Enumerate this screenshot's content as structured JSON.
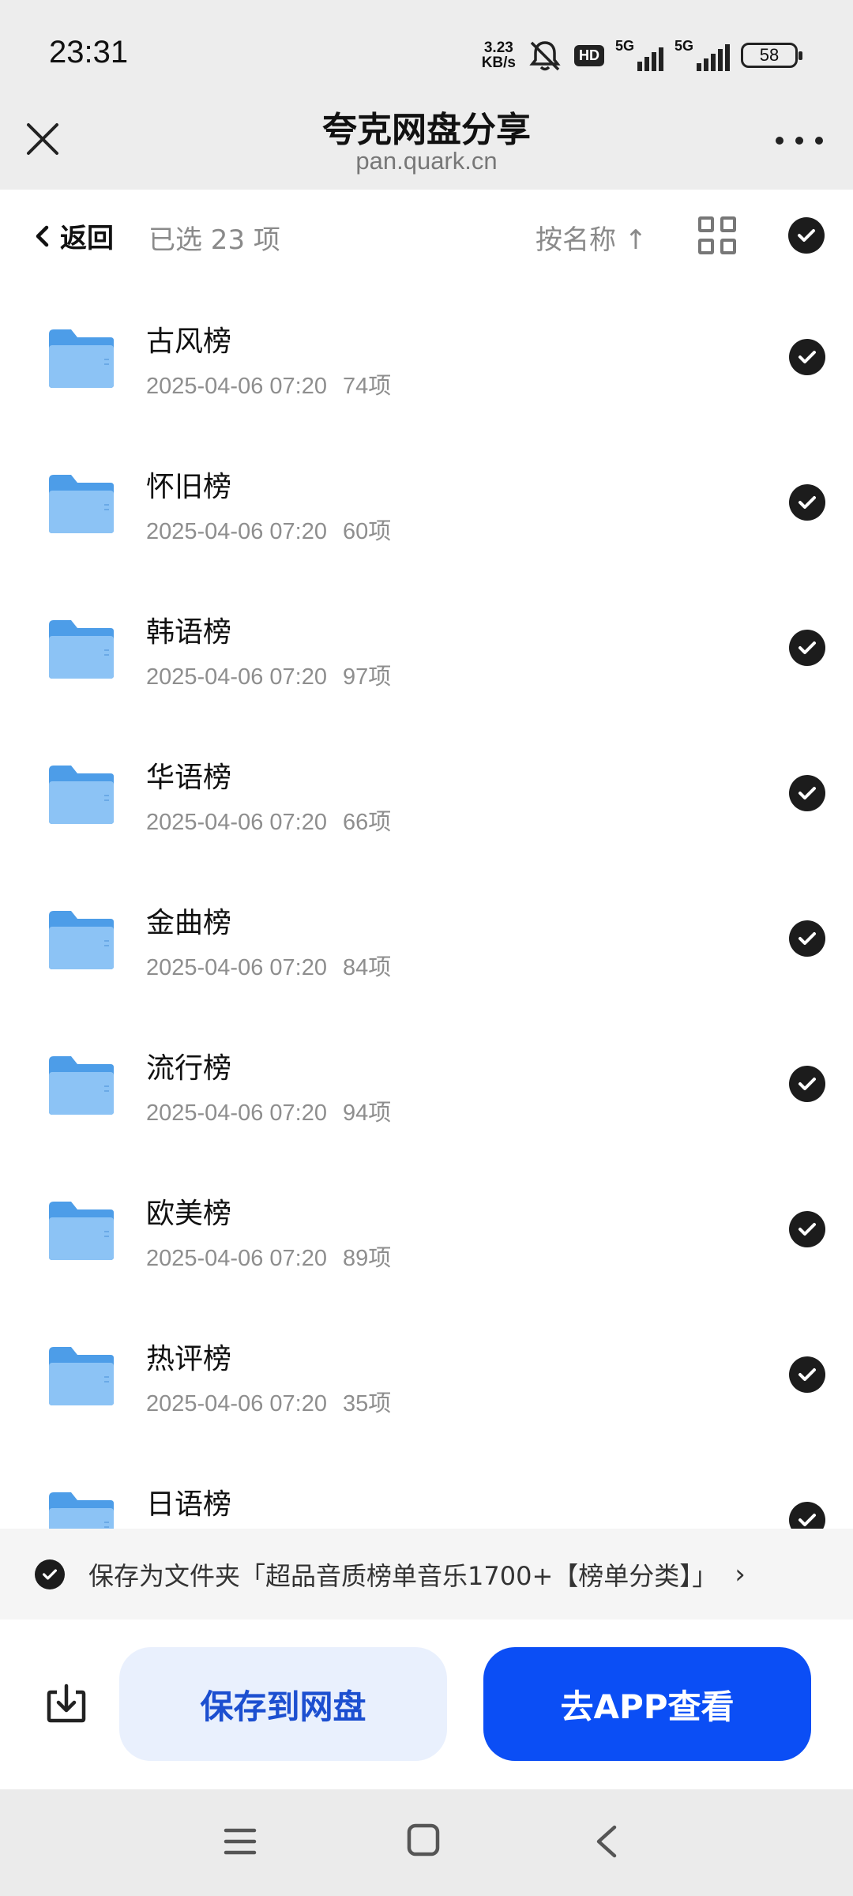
{
  "status_bar": {
    "time": "23:31",
    "net_speed_value": "3.23",
    "net_speed_unit": "KB/s",
    "hd_label": "HD",
    "sim1_label": "5G",
    "sim2_label": "5G",
    "battery": "58",
    "icons": [
      "bell-muted-icon",
      "hd-icon",
      "signal-icon",
      "signal-icon",
      "battery-icon"
    ]
  },
  "title_bar": {
    "title": "夸克网盘分享",
    "subtitle": "pan.quark.cn"
  },
  "toolbar": {
    "back_label": "返回",
    "selected_text": "已选 23 项",
    "sort_label": "按名称 ↑"
  },
  "files": [
    {
      "name": "古风榜",
      "date": "2025-04-06 07:20",
      "count": "74项"
    },
    {
      "name": "怀旧榜",
      "date": "2025-04-06 07:20",
      "count": "60项"
    },
    {
      "name": "韩语榜",
      "date": "2025-04-06 07:20",
      "count": "97项"
    },
    {
      "name": "华语榜",
      "date": "2025-04-06 07:20",
      "count": "66项"
    },
    {
      "name": "金曲榜",
      "date": "2025-04-06 07:20",
      "count": "84项"
    },
    {
      "name": "流行榜",
      "date": "2025-04-06 07:20",
      "count": "94项"
    },
    {
      "name": "欧美榜",
      "date": "2025-04-06 07:20",
      "count": "89项"
    },
    {
      "name": "热评榜",
      "date": "2025-04-06 07:20",
      "count": "35项"
    },
    {
      "name": "日语榜",
      "date": "",
      "count": ""
    }
  ],
  "save_banner": {
    "text": "保存为文件夹「超品音质榜单音乐1700+【榜单分类】」",
    "arrow": "›"
  },
  "actions": {
    "save_label": "保存到网盘",
    "app_label": "去APP查看"
  },
  "colors": {
    "primary_blue": "#0b4ef5",
    "save_btn_bg": "#e9f0fd",
    "folder_blue": "#5aa7ef",
    "check_dark": "#1c1c1c"
  }
}
